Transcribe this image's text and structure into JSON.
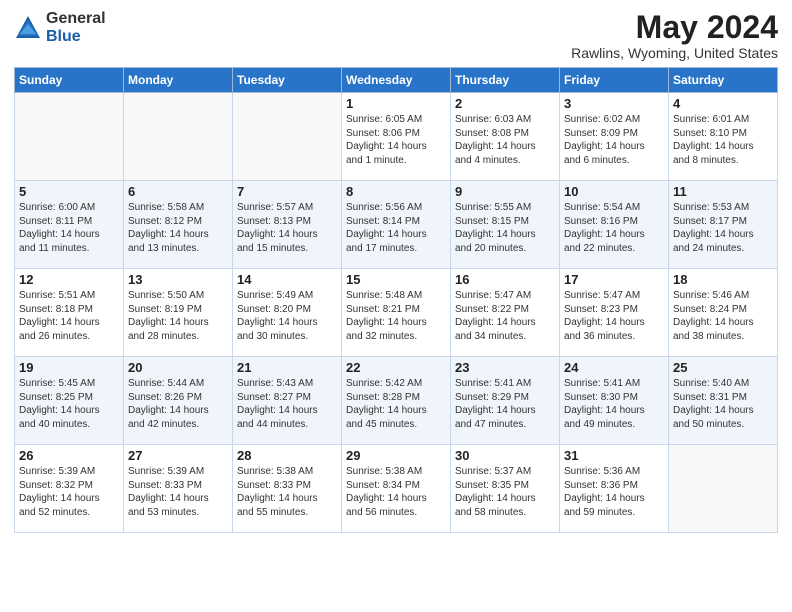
{
  "logo": {
    "general": "General",
    "blue": "Blue"
  },
  "title": "May 2024",
  "location": "Rawlins, Wyoming, United States",
  "days_of_week": [
    "Sunday",
    "Monday",
    "Tuesday",
    "Wednesday",
    "Thursday",
    "Friday",
    "Saturday"
  ],
  "weeks": [
    [
      {
        "day": "",
        "info": ""
      },
      {
        "day": "",
        "info": ""
      },
      {
        "day": "",
        "info": ""
      },
      {
        "day": "1",
        "info": "Sunrise: 6:05 AM\nSunset: 8:06 PM\nDaylight: 14 hours\nand 1 minute."
      },
      {
        "day": "2",
        "info": "Sunrise: 6:03 AM\nSunset: 8:08 PM\nDaylight: 14 hours\nand 4 minutes."
      },
      {
        "day": "3",
        "info": "Sunrise: 6:02 AM\nSunset: 8:09 PM\nDaylight: 14 hours\nand 6 minutes."
      },
      {
        "day": "4",
        "info": "Sunrise: 6:01 AM\nSunset: 8:10 PM\nDaylight: 14 hours\nand 8 minutes."
      }
    ],
    [
      {
        "day": "5",
        "info": "Sunrise: 6:00 AM\nSunset: 8:11 PM\nDaylight: 14 hours\nand 11 minutes."
      },
      {
        "day": "6",
        "info": "Sunrise: 5:58 AM\nSunset: 8:12 PM\nDaylight: 14 hours\nand 13 minutes."
      },
      {
        "day": "7",
        "info": "Sunrise: 5:57 AM\nSunset: 8:13 PM\nDaylight: 14 hours\nand 15 minutes."
      },
      {
        "day": "8",
        "info": "Sunrise: 5:56 AM\nSunset: 8:14 PM\nDaylight: 14 hours\nand 17 minutes."
      },
      {
        "day": "9",
        "info": "Sunrise: 5:55 AM\nSunset: 8:15 PM\nDaylight: 14 hours\nand 20 minutes."
      },
      {
        "day": "10",
        "info": "Sunrise: 5:54 AM\nSunset: 8:16 PM\nDaylight: 14 hours\nand 22 minutes."
      },
      {
        "day": "11",
        "info": "Sunrise: 5:53 AM\nSunset: 8:17 PM\nDaylight: 14 hours\nand 24 minutes."
      }
    ],
    [
      {
        "day": "12",
        "info": "Sunrise: 5:51 AM\nSunset: 8:18 PM\nDaylight: 14 hours\nand 26 minutes."
      },
      {
        "day": "13",
        "info": "Sunrise: 5:50 AM\nSunset: 8:19 PM\nDaylight: 14 hours\nand 28 minutes."
      },
      {
        "day": "14",
        "info": "Sunrise: 5:49 AM\nSunset: 8:20 PM\nDaylight: 14 hours\nand 30 minutes."
      },
      {
        "day": "15",
        "info": "Sunrise: 5:48 AM\nSunset: 8:21 PM\nDaylight: 14 hours\nand 32 minutes."
      },
      {
        "day": "16",
        "info": "Sunrise: 5:47 AM\nSunset: 8:22 PM\nDaylight: 14 hours\nand 34 minutes."
      },
      {
        "day": "17",
        "info": "Sunrise: 5:47 AM\nSunset: 8:23 PM\nDaylight: 14 hours\nand 36 minutes."
      },
      {
        "day": "18",
        "info": "Sunrise: 5:46 AM\nSunset: 8:24 PM\nDaylight: 14 hours\nand 38 minutes."
      }
    ],
    [
      {
        "day": "19",
        "info": "Sunrise: 5:45 AM\nSunset: 8:25 PM\nDaylight: 14 hours\nand 40 minutes."
      },
      {
        "day": "20",
        "info": "Sunrise: 5:44 AM\nSunset: 8:26 PM\nDaylight: 14 hours\nand 42 minutes."
      },
      {
        "day": "21",
        "info": "Sunrise: 5:43 AM\nSunset: 8:27 PM\nDaylight: 14 hours\nand 44 minutes."
      },
      {
        "day": "22",
        "info": "Sunrise: 5:42 AM\nSunset: 8:28 PM\nDaylight: 14 hours\nand 45 minutes."
      },
      {
        "day": "23",
        "info": "Sunrise: 5:41 AM\nSunset: 8:29 PM\nDaylight: 14 hours\nand 47 minutes."
      },
      {
        "day": "24",
        "info": "Sunrise: 5:41 AM\nSunset: 8:30 PM\nDaylight: 14 hours\nand 49 minutes."
      },
      {
        "day": "25",
        "info": "Sunrise: 5:40 AM\nSunset: 8:31 PM\nDaylight: 14 hours\nand 50 minutes."
      }
    ],
    [
      {
        "day": "26",
        "info": "Sunrise: 5:39 AM\nSunset: 8:32 PM\nDaylight: 14 hours\nand 52 minutes."
      },
      {
        "day": "27",
        "info": "Sunrise: 5:39 AM\nSunset: 8:33 PM\nDaylight: 14 hours\nand 53 minutes."
      },
      {
        "day": "28",
        "info": "Sunrise: 5:38 AM\nSunset: 8:33 PM\nDaylight: 14 hours\nand 55 minutes."
      },
      {
        "day": "29",
        "info": "Sunrise: 5:38 AM\nSunset: 8:34 PM\nDaylight: 14 hours\nand 56 minutes."
      },
      {
        "day": "30",
        "info": "Sunrise: 5:37 AM\nSunset: 8:35 PM\nDaylight: 14 hours\nand 58 minutes."
      },
      {
        "day": "31",
        "info": "Sunrise: 5:36 AM\nSunset: 8:36 PM\nDaylight: 14 hours\nand 59 minutes."
      },
      {
        "day": "",
        "info": ""
      }
    ]
  ]
}
